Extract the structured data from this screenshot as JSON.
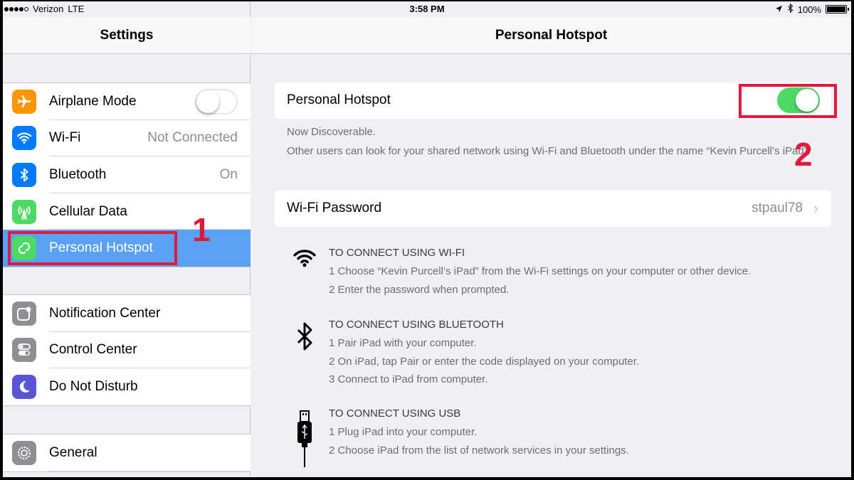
{
  "status_bar": {
    "carrier": "Verizon",
    "network": "LTE",
    "time": "3:58 PM",
    "battery": "100%"
  },
  "sidebar": {
    "title": "Settings",
    "groups": [
      [
        {
          "label": "Airplane Mode",
          "icon": "airplane-icon",
          "color": "#ff9500",
          "toggle": false
        },
        {
          "label": "Wi-Fi",
          "value": "Not Connected",
          "icon": "wifi-icon",
          "color": "#007aff"
        },
        {
          "label": "Bluetooth",
          "value": "On",
          "icon": "bluetooth-icon",
          "color": "#007aff"
        },
        {
          "label": "Cellular Data",
          "icon": "cellular-icon",
          "color": "#4cd964"
        },
        {
          "label": "Personal Hotspot",
          "icon": "hotspot-icon",
          "color": "#4cd964",
          "selected": true
        }
      ],
      [
        {
          "label": "Notification Center",
          "icon": "notification-icon",
          "color": "#8e8e93"
        },
        {
          "label": "Control Center",
          "icon": "control-center-icon",
          "color": "#8e8e93"
        },
        {
          "label": "Do Not Disturb",
          "icon": "moon-icon",
          "color": "#5856d6"
        }
      ],
      [
        {
          "label": "General",
          "icon": "gear-icon",
          "color": "#8e8e93"
        }
      ]
    ]
  },
  "annotations": {
    "marker_1": "1",
    "marker_2": "2",
    "color": "#e1193c"
  },
  "detail": {
    "title": "Personal Hotspot",
    "hotspot_label": "Personal Hotspot",
    "hotspot_on": true,
    "discoverable": "Now Discoverable.",
    "discoverable_desc": "Other users can look for your shared network using Wi-Fi and Bluetooth under the name “Kevin Purcell’s iPad”.",
    "wifi_password_label": "Wi-Fi Password",
    "wifi_password_value": "stpaul78",
    "sections": [
      {
        "icon": "wifi-icon",
        "title": "TO CONNECT USING WI-FI",
        "lines": [
          "1 Choose “Kevin Purcell’s iPad” from the Wi-Fi settings on your computer or other device.",
          "2 Enter the password when prompted."
        ]
      },
      {
        "icon": "bluetooth-icon",
        "title": "TO CONNECT USING BLUETOOTH",
        "lines": [
          "1 Pair iPad with your computer.",
          "2 On iPad, tap Pair or enter the code displayed on your computer.",
          "3 Connect to iPad from computer."
        ]
      },
      {
        "icon": "usb-cable-icon",
        "title": "TO CONNECT USING USB",
        "lines": [
          "1 Plug iPad into your computer.",
          "2 Choose iPad from the list of network services in your settings."
        ]
      }
    ]
  }
}
